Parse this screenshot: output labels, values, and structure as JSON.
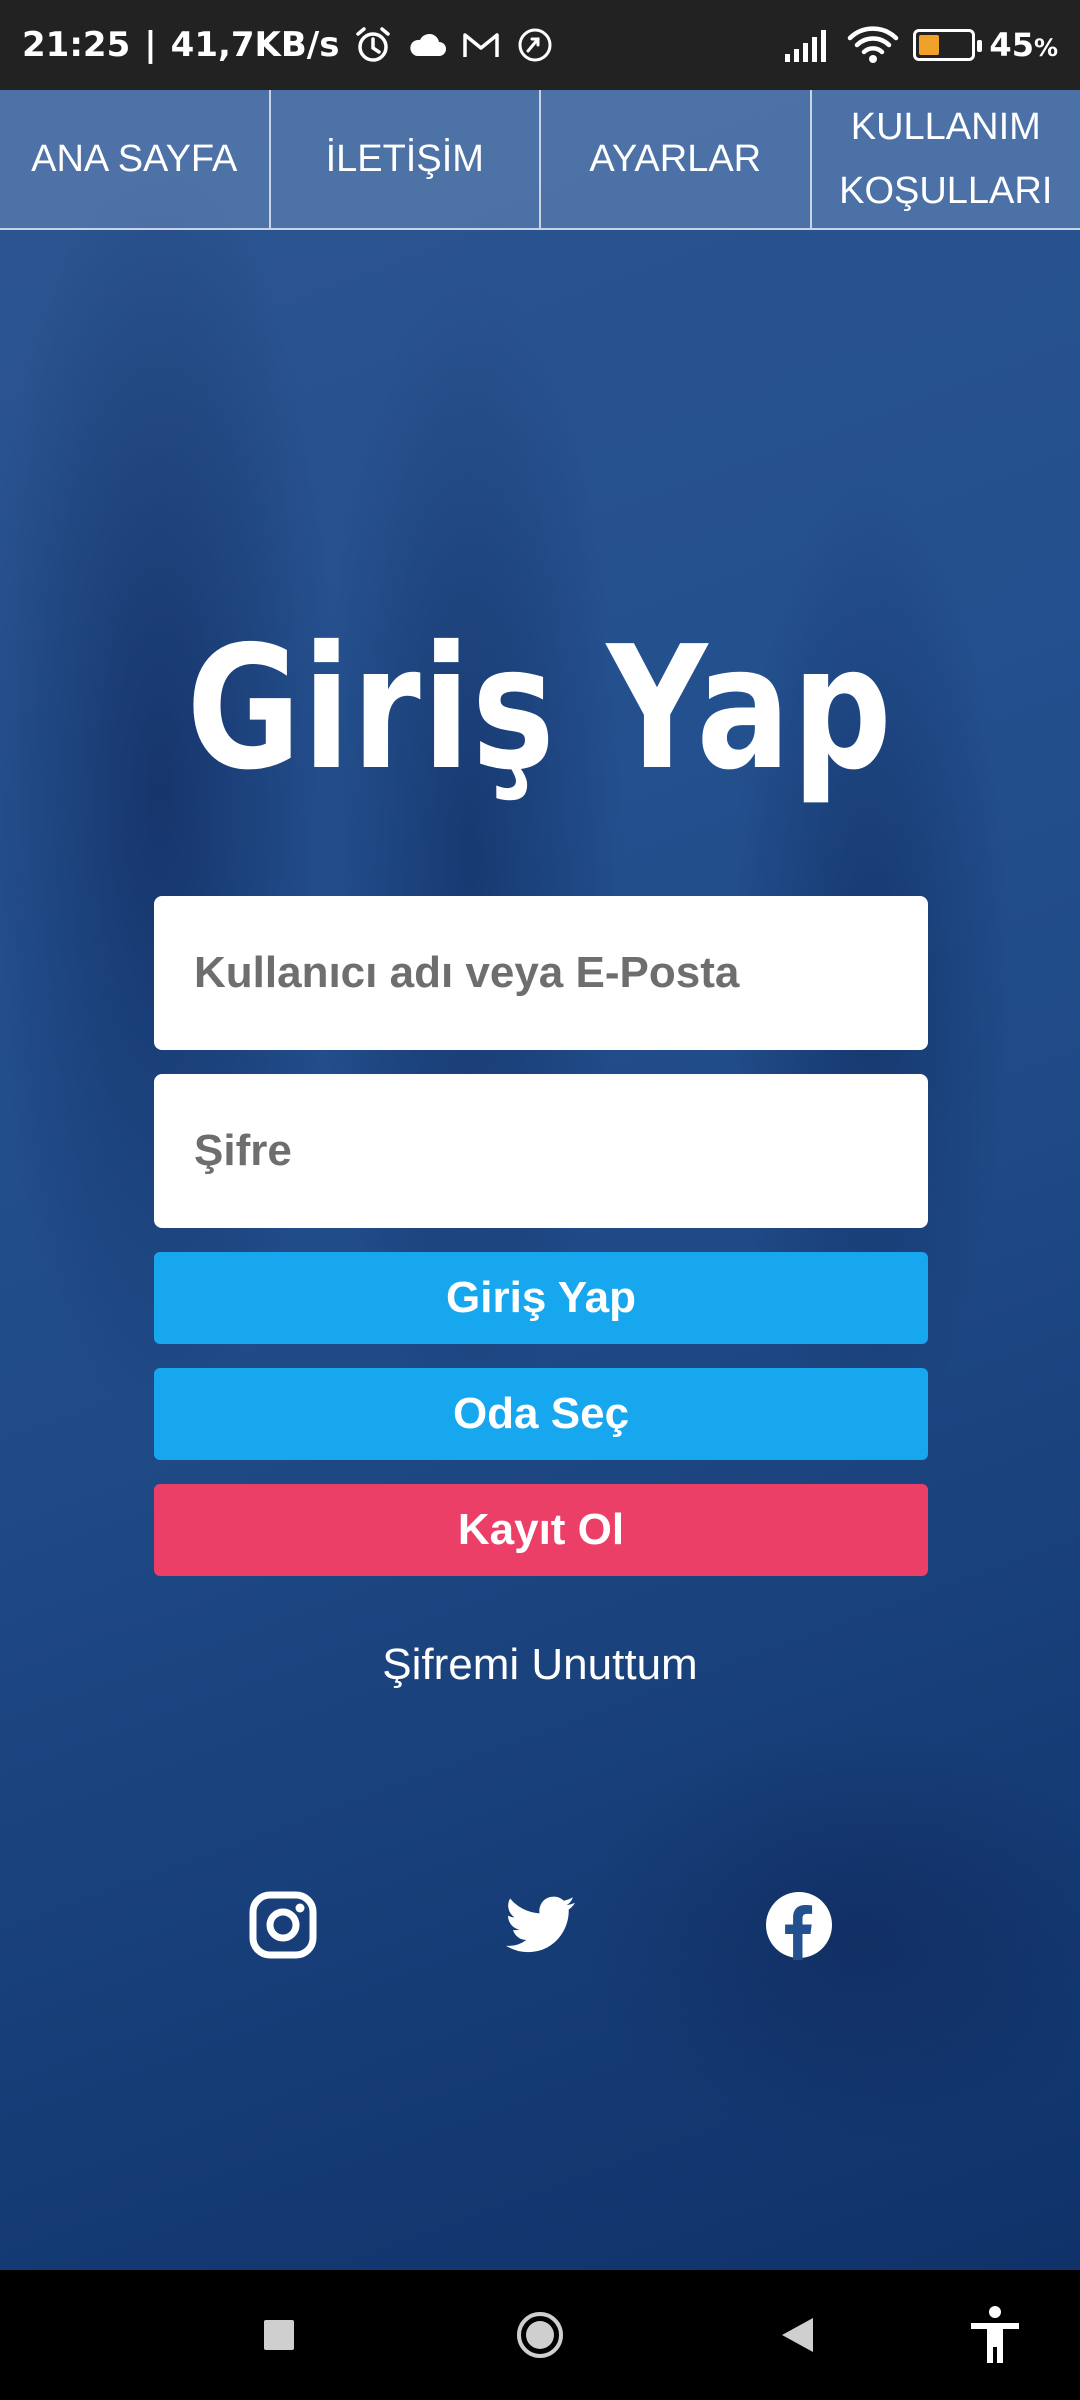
{
  "status_bar": {
    "time": "21:25",
    "network_speed": "41,7KB/s",
    "battery_percent": "45",
    "battery_unit": "%",
    "battery_level": 0.45,
    "icons": [
      "alarm-icon",
      "cloud-icon",
      "gmail-icon",
      "sync-icon",
      "signal-icon",
      "wifi-icon",
      "battery-icon"
    ]
  },
  "nav": {
    "items": [
      {
        "label": "ANA SAYFA"
      },
      {
        "label": "İLETİŞİM"
      },
      {
        "label": "AYARLAR"
      },
      {
        "label": "KULLANIM KOŞULLARI"
      }
    ]
  },
  "login": {
    "title": "Giriş Yap",
    "username_placeholder": "Kullanıcı adı veya E-Posta",
    "password_placeholder": "Şifre",
    "login_button": "Giriş Yap",
    "room_button": "Oda Seç",
    "register_button": "Kayıt Ol",
    "forgot_link": "Şifremi Unuttum"
  },
  "social": [
    "instagram-icon",
    "twitter-icon",
    "facebook-icon"
  ],
  "colors": {
    "primary_button": "#17a7ef",
    "register_button": "#ec3f67",
    "background": "#23508e"
  },
  "system_nav": [
    "recents-button",
    "home-button",
    "back-button",
    "accessibility-button"
  ]
}
